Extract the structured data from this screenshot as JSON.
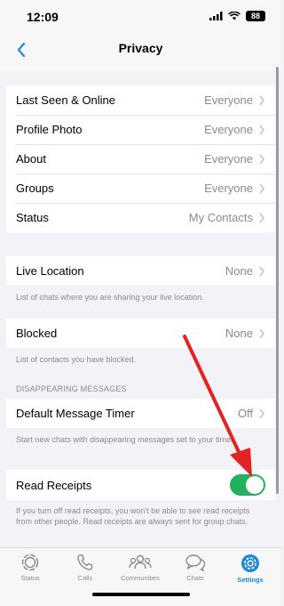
{
  "status_bar": {
    "time": "12:09",
    "battery": "88"
  },
  "nav": {
    "title": "Privacy"
  },
  "privacy_rows": [
    {
      "label": "Last Seen & Online",
      "value": "Everyone"
    },
    {
      "label": "Profile Photo",
      "value": "Everyone"
    },
    {
      "label": "About",
      "value": "Everyone"
    },
    {
      "label": "Groups",
      "value": "Everyone"
    },
    {
      "label": "Status",
      "value": "My Contacts"
    }
  ],
  "live_location": {
    "label": "Live Location",
    "value": "None",
    "note": "List of chats where you are sharing your live location."
  },
  "blocked": {
    "label": "Blocked",
    "value": "None",
    "note": "List of contacts you have blocked."
  },
  "disappearing": {
    "header": "DISAPPEARING MESSAGES",
    "label": "Default Message Timer",
    "value": "Off",
    "note": "Start new chats with disappearing messages set to your timer."
  },
  "read_receipts": {
    "label": "Read Receipts",
    "enabled": true,
    "note": "If you turn off read receipts, you won't be able to see read receipts from other people. Read receipts are always sent for group chats."
  },
  "tabs": [
    {
      "label": "Status",
      "icon": "status-icon"
    },
    {
      "label": "Calls",
      "icon": "phone-icon"
    },
    {
      "label": "Communities",
      "icon": "communities-icon"
    },
    {
      "label": "Chats",
      "icon": "chats-icon"
    },
    {
      "label": "Settings",
      "icon": "gear-icon",
      "active": true
    }
  ],
  "colors": {
    "accent": "#1f8bd8",
    "toggle_on": "#22b15e",
    "arrow": "#e32222"
  }
}
